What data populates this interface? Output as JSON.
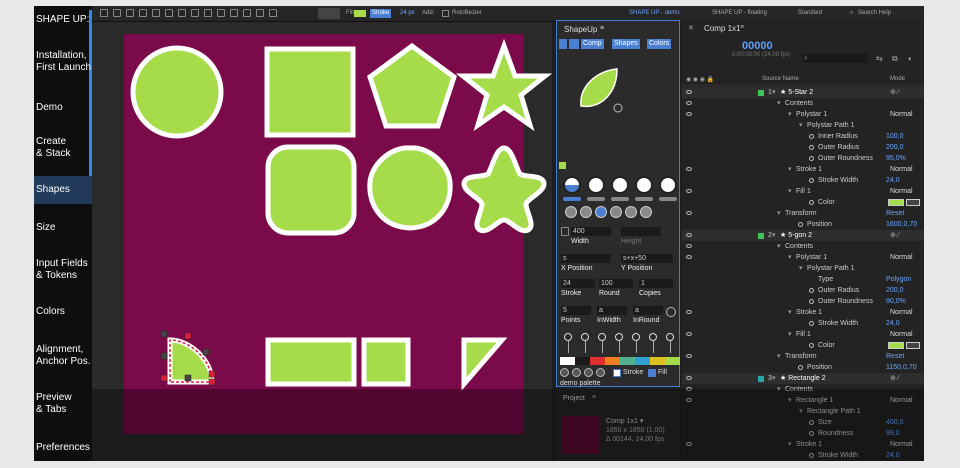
{
  "sidebar": {
    "title": "SHAPE UP:",
    "items": [
      {
        "label": "Installation,\nFirst Launch",
        "active": false
      },
      {
        "label": "Demo",
        "active": false
      },
      {
        "label": "Create\n& Stack",
        "active": false
      },
      {
        "label": "Shapes",
        "active": true
      },
      {
        "label": "Size",
        "active": false
      },
      {
        "label": "Input Fields\n& Tokens",
        "active": false
      },
      {
        "label": "Colors",
        "active": false
      },
      {
        "label": "Alignment,\nAnchor Pos.",
        "active": false
      },
      {
        "label": "Preview\n& Tabs",
        "active": false
      },
      {
        "label": "Preferences",
        "active": false
      }
    ]
  },
  "toolbar": {
    "fill_label": "Fill",
    "stroke_label": "Stroke",
    "stroke_value": "24 px",
    "add_label": "Add:",
    "rotobezier_label": "RotoBezier",
    "workspace_shape_up_demo": "SHAPE UP - demo",
    "workspace_shape_up_floating": "SHAPE UP - floating",
    "workspace_standard": "Standard",
    "search_help_placeholder": "Search Help"
  },
  "colors": {
    "canvas": "#7b0a4a",
    "shape_fill": "#a6dc49",
    "shape_stroke": "#ffffff",
    "accent": "#3e7ed6",
    "selection": "#e0203a"
  },
  "shapeup": {
    "title": "ShapeUp",
    "tabs": [
      "Comp",
      "Shapes",
      "Colors"
    ],
    "fields": {
      "width": {
        "value": "400",
        "label": "Width"
      },
      "height": {
        "value": "",
        "label": "Height"
      },
      "x_position": {
        "value": "s",
        "label": "X Position"
      },
      "y_position": {
        "value": "s+x+50",
        "label": "Y Position"
      },
      "stroke": {
        "value": "24",
        "label": "Stroke"
      },
      "round": {
        "value": "100",
        "label": "Round"
      },
      "copies": {
        "value": "1",
        "label": "Copies"
      },
      "points": {
        "value": "5",
        "label": "Points"
      },
      "inwidth": {
        "value": "a",
        "label": "InWidth"
      },
      "inround": {
        "value": "a",
        "label": "InRound"
      }
    },
    "stroke_toggle": "Stroke",
    "fill_toggle": "Fill",
    "palette_label": "demo palette",
    "palette_colors": [
      "#ffffff",
      "#1a1a1a",
      "#e03030",
      "#f08020",
      "#50b090",
      "#30a0d0",
      "#e0c020",
      "#a6dc49"
    ]
  },
  "project": {
    "title": "Project",
    "comp_name": "Comp 1x1 ▾",
    "comp_size": "1850 x 1850 (1,00)",
    "comp_duration": "Δ 00144, 24,00 fps"
  },
  "timeline": {
    "tab": "Comp 1x1",
    "timecode": "00000",
    "timecode_sub": "0:00:00:00 (24.00 fps)",
    "search_placeholder": "⌕",
    "col_source": "Source Name",
    "col_mode": "Mode",
    "rows": [
      {
        "indent": 0,
        "num": "1",
        "label": "★ 5-Star 2",
        "swatch": "#3fc55a",
        "layer": true
      },
      {
        "indent": 1,
        "label": "Contents"
      },
      {
        "indent": 2,
        "label": "Polystar 1",
        "mode": "Normal"
      },
      {
        "indent": 3,
        "label": "Polystar Path 1"
      },
      {
        "indent": 4,
        "label": "Inner Radius",
        "value": "100,0",
        "stopwatch": true
      },
      {
        "indent": 4,
        "label": "Outer Radius",
        "value": "200,0",
        "stopwatch": true
      },
      {
        "indent": 4,
        "label": "Outer Roundness",
        "value": "95,0%",
        "stopwatch": true
      },
      {
        "indent": 2,
        "label": "Stroke 1",
        "mode": "Normal"
      },
      {
        "indent": 4,
        "label": "Stroke Width",
        "value": "24,0",
        "stopwatch": true
      },
      {
        "indent": 2,
        "label": "Fill 1",
        "mode": "Normal"
      },
      {
        "indent": 4,
        "label": "Color",
        "color": "#a6dc49",
        "stopwatch": true
      },
      {
        "indent": 1,
        "label": "Transform",
        "value": "Reset"
      },
      {
        "indent": 3,
        "label": "Position",
        "value": "1600,0,70",
        "stopwatch": true
      },
      {
        "indent": 0,
        "num": "2",
        "label": "★ 5-gon 2",
        "swatch": "#3fc55a",
        "layer": true
      },
      {
        "indent": 1,
        "label": "Contents"
      },
      {
        "indent": 2,
        "label": "Polystar 1",
        "mode": "Normal"
      },
      {
        "indent": 3,
        "label": "Polystar Path 1"
      },
      {
        "indent": 4,
        "label": "Type",
        "value": "Polygon"
      },
      {
        "indent": 4,
        "label": "Outer Radius",
        "value": "200,0",
        "stopwatch": true
      },
      {
        "indent": 4,
        "label": "Outer Roundness",
        "value": "90,0%",
        "stopwatch": true
      },
      {
        "indent": 2,
        "label": "Stroke 1",
        "mode": "Normal"
      },
      {
        "indent": 4,
        "label": "Stroke Width",
        "value": "24,0",
        "stopwatch": true
      },
      {
        "indent": 2,
        "label": "Fill 1",
        "mode": "Normal"
      },
      {
        "indent": 4,
        "label": "Color",
        "color": "#a6dc49",
        "stopwatch": true
      },
      {
        "indent": 1,
        "label": "Transform",
        "value": "Reset"
      },
      {
        "indent": 3,
        "label": "Position",
        "value": "1150,0,70",
        "stopwatch": true
      },
      {
        "indent": 0,
        "num": "3",
        "label": "★ Rectangle 2",
        "swatch": "#2aa8a8",
        "layer": true
      },
      {
        "indent": 1,
        "label": "Contents"
      },
      {
        "indent": 2,
        "label": "Rectangle 1",
        "mode": "Normal"
      },
      {
        "indent": 3,
        "label": "Rectangle Path 1"
      },
      {
        "indent": 4,
        "label": "Size",
        "value": "400,0",
        "stopwatch": true
      },
      {
        "indent": 4,
        "label": "Roundness",
        "value": "99,0",
        "stopwatch": true
      },
      {
        "indent": 2,
        "label": "Stroke 1",
        "mode": "Normal"
      },
      {
        "indent": 4,
        "label": "Stroke Width",
        "value": "24,0",
        "stopwatch": true
      }
    ]
  }
}
